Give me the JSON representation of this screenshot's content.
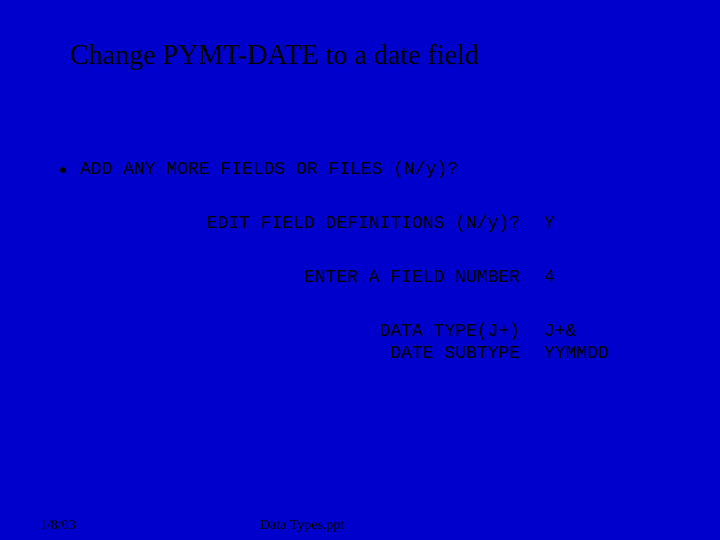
{
  "title": "Change PYMT-DATE to a date field",
  "lines": {
    "l1": "ADD ANY MORE FIELDS OR FILES (N/y)?",
    "l2_label": "EDIT FIELD DEFINITIONS (N/y)?",
    "l2_answer": "Y",
    "l3_label": "ENTER A FIELD NUMBER",
    "l3_answer": "4",
    "l4_label": "DATA TYPE(J+)",
    "l4_answer": "J+&",
    "l5_label": "DATE SUBTYPE",
    "l5_answer": "YYMMDD"
  },
  "footer": {
    "date": "1/8/03",
    "file": "Data Types.ppt"
  }
}
